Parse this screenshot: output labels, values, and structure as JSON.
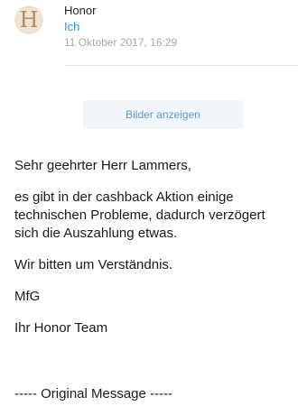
{
  "header": {
    "avatar_letter": "H",
    "sender": "Honor",
    "recipient": "Ich",
    "datetime": "11 Oktober 2017, 16:29"
  },
  "show_images_label": "Bilder anzeigen",
  "body": {
    "greeting": "Sehr geehrter Herr Lammers,",
    "paragraph1": "es gibt in der cashback Aktion einige technischen Probleme, dadurch verzögert sich die Auszahlung etwas.",
    "paragraph2": "Wir bitten um Verständnis.",
    "closing": "MfG",
    "signature": "Ihr Honor Team"
  },
  "original_message": "----- Original Message -----"
}
